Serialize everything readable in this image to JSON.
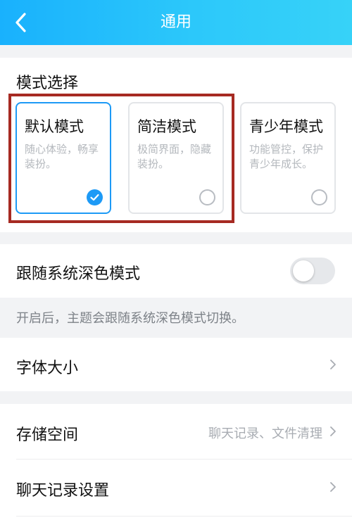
{
  "header": {
    "title": "通用",
    "back_icon": "chevron-left-icon"
  },
  "mode_section": {
    "label": "模式选择",
    "cards": [
      {
        "title": "默认模式",
        "desc": "随心体验，畅享装扮。",
        "selected": true
      },
      {
        "title": "简洁模式",
        "desc": "极简界面，隐藏装扮。",
        "selected": false
      },
      {
        "title": "青少年模式",
        "desc": "功能管控，保护青少年成长。",
        "selected": false
      }
    ],
    "highlight_color": "#a62a22"
  },
  "dark_mode": {
    "label": "跟随系统深色模式",
    "enabled": false,
    "hint": "开启后，主题会跟随系统深色模式切换。"
  },
  "font_size": {
    "label": "字体大小"
  },
  "storage": {
    "label": "存储空间",
    "value": "聊天记录、文件清理"
  },
  "chat_history": {
    "label": "聊天记录设置"
  },
  "colors": {
    "header_start": "#19b1fd",
    "header_end": "#37d2f8",
    "accent": "#1d9af6"
  }
}
